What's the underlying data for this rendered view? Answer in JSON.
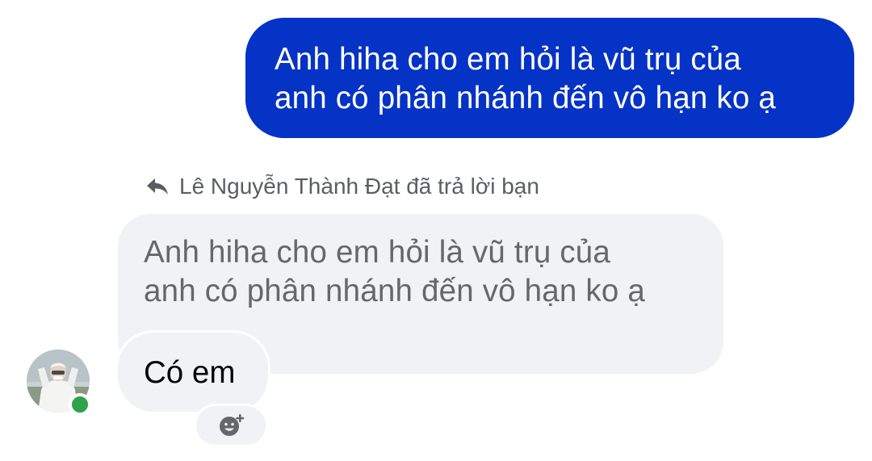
{
  "sent_message": {
    "line1": "Anh hiha cho em hỏi là vũ trụ của",
    "line2": "anh có phân nhánh đến vô hạn ko ạ"
  },
  "reply_header": {
    "icon": "reply-arrow-icon",
    "text": "Lê Nguyễn Thành Đạt đã trả lời bạn"
  },
  "quoted_message": {
    "line1": "Anh hiha cho em hỏi là vũ trụ của",
    "line2": "anh có phân nhánh đến vô hạn ko ạ"
  },
  "reply_message": {
    "text": "Có em"
  },
  "sender": {
    "avatar_icon": "user-avatar",
    "status": "online"
  },
  "reaction_button": {
    "icon": "add-reaction-icon"
  },
  "colors": {
    "sent_bubble": "#0433c6",
    "received_bubble": "#f0f2f5",
    "online": "#31a24c",
    "secondary_text": "#65676b"
  }
}
